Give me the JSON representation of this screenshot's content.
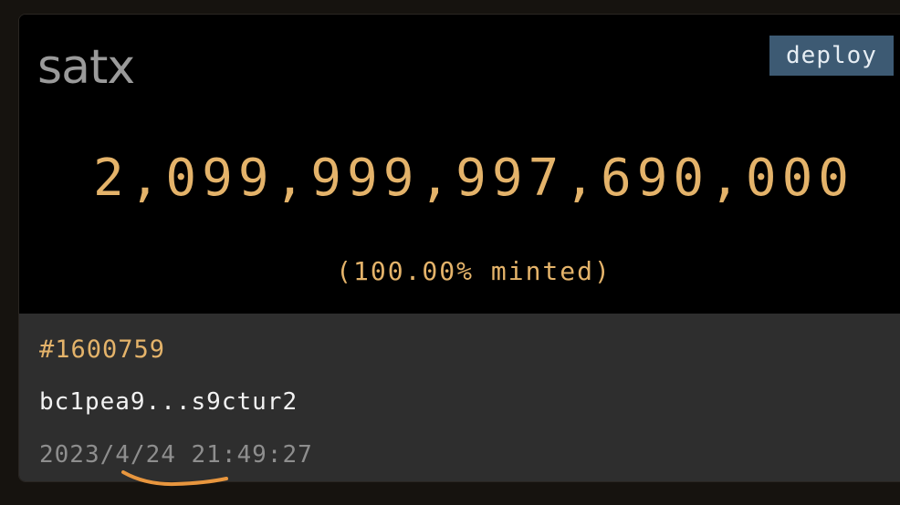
{
  "card": {
    "ticker": "satx",
    "badge": "deploy",
    "supply": "2,099,999,997,690,000",
    "minted": "(100.00% minted)",
    "inscription_number": "#1600759",
    "address": "bc1pea9...s9ctur2",
    "timestamp": "2023/4/24 21:49:27"
  },
  "colors": {
    "background": "#000000",
    "accent": "#e4b36a",
    "badge_bg": "#3d5a73",
    "footer_bg": "#2e2e2e",
    "annotation": "#e8963e"
  }
}
